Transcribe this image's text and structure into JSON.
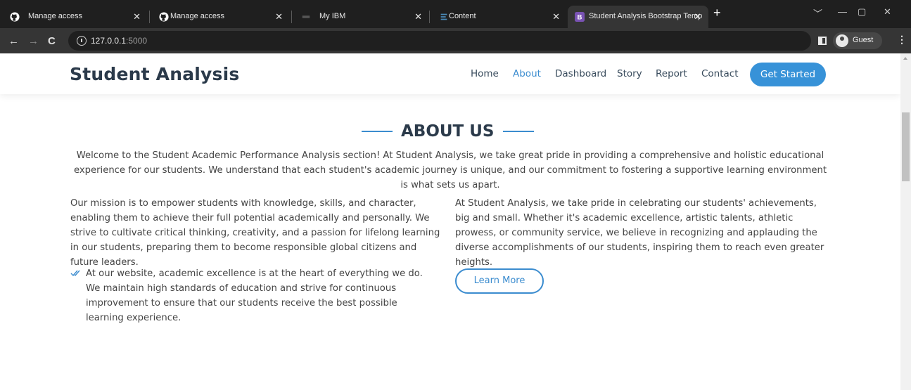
{
  "browser": {
    "tabs": [
      {
        "title": "Manage access",
        "icon": "github-icon"
      },
      {
        "title": "Manage access",
        "icon": "github-icon"
      },
      {
        "title": "My IBM",
        "icon": "ibm-icon"
      },
      {
        "title": "Content",
        "icon": "content-icon"
      },
      {
        "title": "Student Analysis Bootstrap Temp",
        "icon": "bootstrap-icon",
        "active": true
      }
    ],
    "close_glyph": "✕",
    "new_tab_glyph": "+",
    "url_host": "127.0.0.1",
    "url_port": ":5000",
    "guest_label": "Guest"
  },
  "site": {
    "logo": "Student Analysis",
    "nav": [
      "Home",
      "About",
      "Dashboard",
      "Story",
      "Report",
      "Contact"
    ],
    "active_nav": "About",
    "cta": "Get Started",
    "accent_color": "#3b8ccf"
  },
  "about": {
    "title": "ABOUT US",
    "intro": "Welcome to the Student Academic Performance Analysis section! At Student Analysis, we take great pride in providing a comprehensive and holistic educational experience for our students. We understand that each student's academic journey is unique, and our commitment to fostering a supportive learning environment is what sets us apart.",
    "left_paragraph": "Our mission is to empower students with knowledge, skills, and character, enabling them to achieve their full potential academically and personally. We strive to cultivate critical thinking, creativity, and a passion for lifelong learning in our students, preparing them to become responsible global citizens and future leaders.",
    "check_item": "At our website, academic excellence is at the heart of everything we do. We maintain high standards of education and strive for continuous improvement to ensure that our students receive the best possible learning experience.",
    "right_paragraph": "At Student Analysis, we take pride in celebrating our students' achievements, big and small. Whether it's academic excellence, artistic talents, athletic prowess, or community service, we believe in recognizing and applauding the diverse accomplishments of our students, inspiring them to reach even greater heights.",
    "learn_more": "Learn More"
  }
}
